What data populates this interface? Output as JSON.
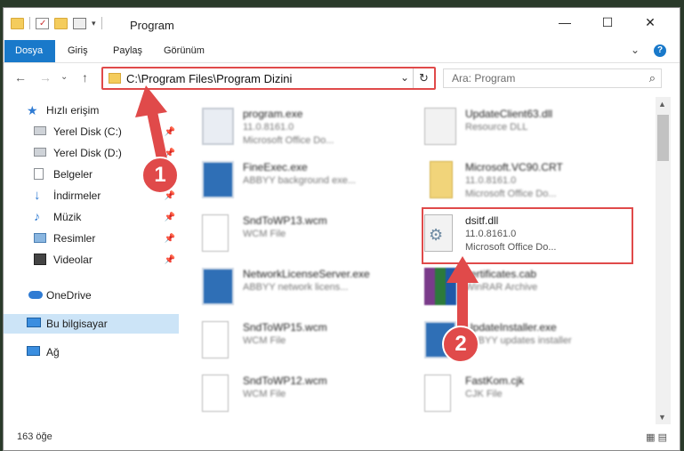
{
  "window": {
    "title": "Program",
    "controls": {
      "minimize": "—",
      "maximize": "☐",
      "close": "✕"
    },
    "help_icon": "?",
    "collapse_icon": "⌄"
  },
  "ribbon": {
    "tabs": [
      {
        "label": "Dosya",
        "active": true
      },
      {
        "label": "Giriş"
      },
      {
        "label": "Paylaş"
      },
      {
        "label": "Görünüm"
      }
    ]
  },
  "nav": {
    "back": "←",
    "forward": "→",
    "history": "⌄",
    "up": "↑",
    "address": "C:\\Program Files\\Program Dizini",
    "address_dropdown": "⌄",
    "refresh": "↻",
    "search_placeholder": "Ara: Program",
    "search_icon": "⌕"
  },
  "sidebar": {
    "items": [
      {
        "label": "Hızlı erişim",
        "icon": "star-icon"
      },
      {
        "label": "Yerel Disk (C:)",
        "icon": "drive-icon",
        "pinned": true
      },
      {
        "label": "Yerel Disk (D:)",
        "icon": "drive-icon",
        "pinned": true
      },
      {
        "label": "Belgeler",
        "icon": "documents-icon",
        "pinned": true
      },
      {
        "label": "İndirmeler",
        "icon": "downloads-icon",
        "pinned": true
      },
      {
        "label": "Müzik",
        "icon": "music-icon",
        "pinned": true
      },
      {
        "label": "Resimler",
        "icon": "pictures-icon",
        "pinned": true
      },
      {
        "label": "Videolar",
        "icon": "videos-icon",
        "pinned": true
      },
      {
        "label": "OneDrive",
        "icon": "cloud-icon"
      },
      {
        "label": "Bu bilgisayar",
        "icon": "computer-icon",
        "selected": true
      },
      {
        "label": "Ağ",
        "icon": "network-icon"
      }
    ],
    "pin_glyph": "📌"
  },
  "files": [
    {
      "name": "program.exe",
      "l2": "11.0.8161.0",
      "l3": "Microsoft Office Do...",
      "icon": "exe-icon"
    },
    {
      "name": "UpdateClient63.dll",
      "l2": "Resource DLL",
      "l3": "",
      "icon": "dll-icon"
    },
    {
      "name": "FineExec.exe",
      "l2": "ABBYY background exe...",
      "l3": "",
      "icon": "app-icon"
    },
    {
      "name": "Microsoft.VC90.CRT",
      "l2": "11.0.8161.0",
      "l3": "Microsoft Office Do...",
      "icon": "folder-icon"
    },
    {
      "name": "SndToWP13.wcm",
      "l2": "WCM File",
      "l3": "",
      "icon": "document-icon"
    },
    {
      "name": "dsitf.dll",
      "l2": "11.0.8161.0",
      "l3": "Microsoft Office Do...",
      "icon": "dll-gear-icon"
    },
    {
      "name": "NetworkLicenseServer.exe",
      "l2": "ABBYY network licens...",
      "l3": "",
      "icon": "app-icon"
    },
    {
      "name": "certificates.cab",
      "l2": "WinRAR Archive",
      "l3": "",
      "icon": "archive-icon"
    },
    {
      "name": "SndToWP15.wcm",
      "l2": "WCM File",
      "l3": "",
      "icon": "document-icon"
    },
    {
      "name": "UpdateInstaller.exe",
      "l2": "ABBYY updates installer",
      "l3": "",
      "icon": "app-icon"
    },
    {
      "name": "SndToWP12.wcm",
      "l2": "WCM File",
      "l3": "",
      "icon": "document-icon"
    },
    {
      "name": "FastKom.cjk",
      "l2": "CJK File",
      "l3": "",
      "icon": "document-icon"
    }
  ],
  "status": {
    "count": "163 öğe",
    "view_icons": "▦ ▤"
  },
  "annotations": [
    {
      "label": "1",
      "color": "#e04a4a"
    },
    {
      "label": "2",
      "color": "#e04a4a"
    }
  ]
}
